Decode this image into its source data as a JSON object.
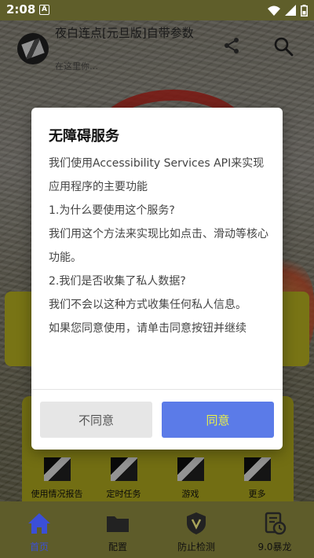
{
  "status_bar": {
    "time": "2:08",
    "notification_letter": "A"
  },
  "app_header": {
    "title": "夜白连点[元旦版]自带参数",
    "subtitle": "在这里你…",
    "icons": [
      "avatar",
      "share-icon",
      "search-icon"
    ]
  },
  "dialog": {
    "title": "无障碍服务",
    "paragraphs": [
      "我们使用Accessibility Services API来实现应用程序的主要功能",
      "1.为什么要使用这个服务?",
      "我们用这个方法来实现比如点击、滑动等核心功能。",
      "2.我们是否收集了私人数据?",
      "我们不会以这种方式收集任何私人信息。",
      "如果您同意使用，请单击同意按钮并继续"
    ],
    "disagree_label": "不同意",
    "agree_label": "同意"
  },
  "grid": [
    {
      "label": "使用情况报告"
    },
    {
      "label": "定时任务"
    },
    {
      "label": "游戏"
    },
    {
      "label": "更多"
    }
  ],
  "bottom_nav": [
    {
      "label": "首页",
      "icon": "home-icon",
      "active": true
    },
    {
      "label": "配置",
      "icon": "folder-icon",
      "active": false
    },
    {
      "label": "防止检测",
      "icon": "shield-v-icon",
      "active": false
    },
    {
      "label": "9.0暴龙",
      "icon": "clock-doc-icon",
      "active": false
    }
  ],
  "colors": {
    "accent": "#3b4fd8",
    "agree_button": "#5b7be8",
    "agree_text": "#e8ef4a",
    "nav_bg": "#5e5c2a"
  }
}
